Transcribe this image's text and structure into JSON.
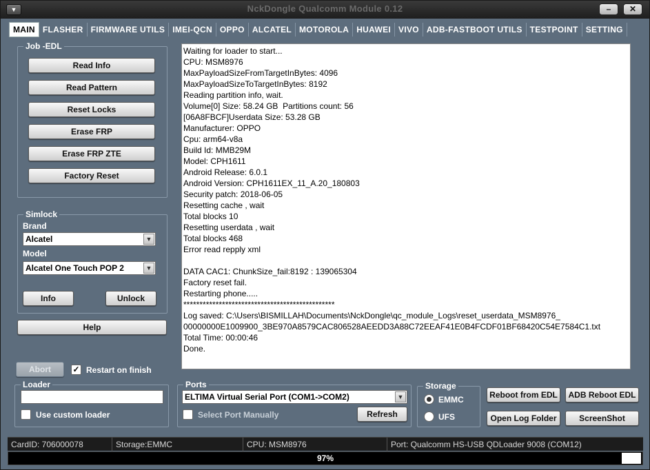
{
  "window": {
    "title": "NckDongle Qualcomm Module 0.12"
  },
  "tabs": [
    "MAIN",
    "FLASHER",
    "FIRMWARE UTILS",
    "IMEI-QCN",
    "OPPO",
    "ALCATEL",
    "MOTOROLA",
    "HUAWEI",
    "VIVO",
    "ADB-FASTBOOT UTILS",
    "TESTPOINT",
    "SETTING"
  ],
  "job_edl": {
    "legend": "Job -EDL",
    "buttons": [
      "Read Info",
      "Read Pattern",
      "Reset Locks",
      "Erase FRP",
      "Erase FRP ZTE",
      "Factory Reset"
    ]
  },
  "simlock": {
    "legend": "Simlock",
    "brand_label": "Brand",
    "brand_value": "Alcatel",
    "model_label": "Model",
    "model_value": "Alcatel One Touch POP 2",
    "info_button": "Info",
    "unlock_button": "Unlock"
  },
  "help_button": "Help",
  "abort_button": "Abort",
  "restart_on_finish": {
    "label": "Restart on finish",
    "checked": true
  },
  "loader": {
    "legend": "Loader",
    "value": "",
    "custom_label": "Use custom loader",
    "custom_checked": false
  },
  "ports": {
    "legend": "Ports",
    "selected": "ELTIMA Virtual Serial Port (COM1->COM2)",
    "manual_label": "Select Port Manually",
    "manual_checked": false,
    "refresh_button": "Refresh"
  },
  "storage": {
    "legend": "Storage",
    "options": [
      "EMMC",
      "UFS"
    ],
    "selected": "EMMC"
  },
  "actions": {
    "reboot_edl": "Reboot from EDL",
    "adb_reboot_edl": "ADB Reboot EDL",
    "open_log": "Open Log Folder",
    "screenshot": "ScreenShot"
  },
  "log": [
    "Waiting for loader to start...",
    "CPU: MSM8976",
    "MaxPayloadSizeFromTargetInBytes: 4096",
    "MaxPayloadSizeToTargetInBytes: 8192",
    "Reading partition info, wait.",
    "Volume[0] Size: 58.24 GB  Partitions count: 56",
    "[06A8FBCF]Userdata Size: 53.28 GB",
    "Manufacturer: OPPO",
    "Cpu: arm64-v8a",
    "Build Id: MMB29M",
    "Model: CPH1611",
    "Android Release: 6.0.1",
    "Android Version: CPH1611EX_11_A.20_180803",
    "Security patch: 2018-06-05",
    "Resetting cache , wait",
    "Total blocks 10",
    "Resetting userdata , wait",
    "Total blocks 468",
    "Error read repply xml",
    "",
    "DATA CAC1: ChunkSize_fail:8192 : 139065304",
    "Factory reset fail.",
    "Restarting phone.....",
    "***********************************************",
    "Log saved: C:\\Users\\BISMILLAH\\Documents\\NckDongle\\qc_module_Logs\\reset_userdata_MSM8976_",
    "00000000E1009900_3BE970A8579CAC806528AEEDD3A88C72EEAF41E0B4FCDF01BF68420C54E7584C1.txt",
    "Total Time: 00:00:46",
    "Done."
  ],
  "status": {
    "card_id": "CardID: 706000078",
    "storage": "Storage:EMMC",
    "cpu": "CPU: MSM8976",
    "port": "Port: Qualcomm HS-USB QDLoader 9008 (COM12)"
  },
  "progress": {
    "value": 97,
    "label": "97%"
  }
}
